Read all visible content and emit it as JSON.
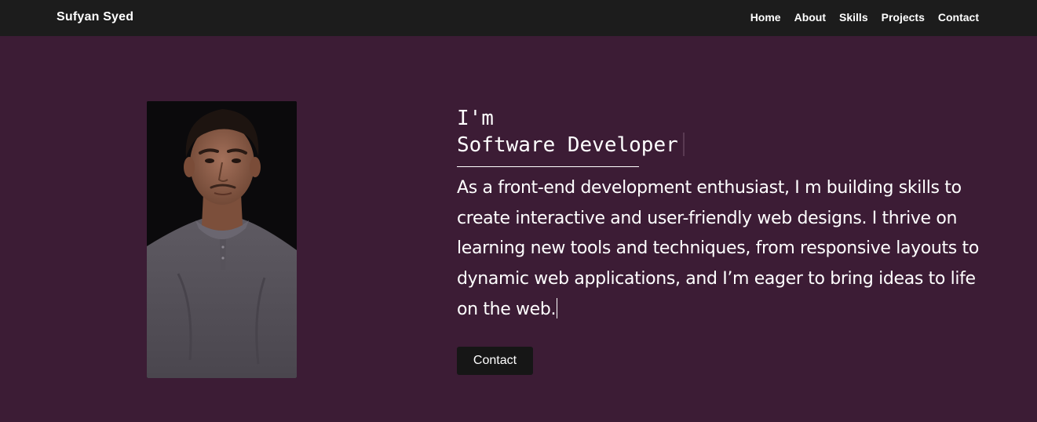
{
  "nav": {
    "brand": "Sufyan Syed",
    "links": [
      "Home",
      "About",
      "Skills",
      "Projects",
      "Contact"
    ]
  },
  "hero": {
    "greeting": "I'm",
    "role": "Software Developer",
    "bio": "As a front-end development enthusiast, I m building skills to create interactive and user-friendly web designs. I thrive on learning new tools and techniques, from responsive layouts to dynamic web applications, and I’m eager to bring ideas to life on the web.",
    "contact_label": "Contact"
  },
  "colors": {
    "background": "#3c1c35",
    "navbar": "#1c1c1c",
    "button": "#161616",
    "text": "#ffffff"
  }
}
